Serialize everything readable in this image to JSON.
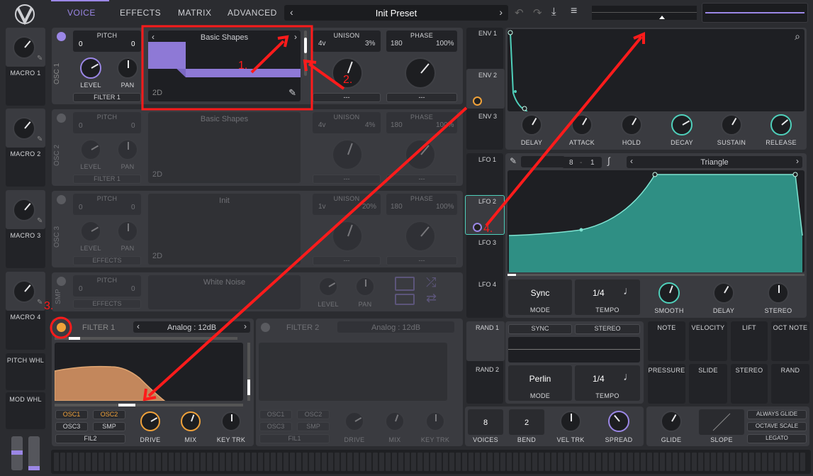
{
  "colors": {
    "accent_purple": "#9b87e6",
    "accent_teal": "#4fd0bb",
    "accent_orange": "#f0a23a",
    "annotation_red": "#ff1b1b"
  },
  "header": {
    "tabs": [
      "VOICE",
      "EFFECTS",
      "MATRIX",
      "ADVANCED"
    ],
    "preset": "Init Preset"
  },
  "macros": [
    {
      "label": "MACRO 1"
    },
    {
      "label": "MACRO 2"
    },
    {
      "label": "MACRO 3"
    },
    {
      "label": "MACRO 4"
    }
  ],
  "wheels": {
    "pitch": "PITCH WHL",
    "mod": "MOD WHL"
  },
  "osc": [
    {
      "name": "OSC 1",
      "pitch": "PITCH",
      "pitch_l": "0",
      "pitch_r": "0",
      "wave": "Basic Shapes",
      "dim": "2D",
      "unison": "UNISON",
      "voices": "4v",
      "detune": "3%",
      "phase": "PHASE",
      "phase_val": "180",
      "phase_pct": "100%",
      "level": "LEVEL",
      "pan": "PAN",
      "dest": "FILTER 1",
      "sel": "---"
    },
    {
      "name": "OSC 2",
      "pitch": "PITCH",
      "pitch_l": "0",
      "pitch_r": "0",
      "wave": "Basic Shapes",
      "dim": "2D",
      "unison": "UNISON",
      "voices": "4v",
      "detune": "4%",
      "phase": "PHASE",
      "phase_val": "180",
      "phase_pct": "100%",
      "level": "LEVEL",
      "pan": "PAN",
      "dest": "FILTER 1",
      "sel": "---"
    },
    {
      "name": "OSC 3",
      "pitch": "PITCH",
      "pitch_l": "0",
      "pitch_r": "0",
      "wave": "Init",
      "dim": "2D",
      "unison": "UNISON",
      "voices": "1v",
      "detune": "20%",
      "phase": "PHASE",
      "phase_val": "180",
      "phase_pct": "100%",
      "level": "LEVEL",
      "pan": "PAN",
      "dest": "EFFECTS",
      "sel": "---"
    }
  ],
  "smp": {
    "name": "SMP",
    "pitch": "PITCH",
    "pitch_l": "0",
    "pitch_r": "0",
    "wave": "White Noise",
    "level": "LEVEL",
    "pan": "PAN",
    "dest": "EFFECTS"
  },
  "filter1": {
    "name": "FILTER 1",
    "type": "Analog : 12dB",
    "routes": [
      "OSC1",
      "OSC2",
      "OSC3",
      "SMP"
    ],
    "fil": "FIL2",
    "drive": "DRIVE",
    "mix": "MIX",
    "keytrk": "KEY TRK"
  },
  "filter2": {
    "name": "FILTER 2",
    "type": "Analog : 12dB",
    "routes": [
      "OSC1",
      "OSC2",
      "OSC3",
      "SMP"
    ],
    "fil": "FIL1",
    "drive": "DRIVE",
    "mix": "MIX",
    "keytrk": "KEY TRK"
  },
  "env": {
    "labels": [
      "ENV 1",
      "ENV 2",
      "ENV 3"
    ],
    "knobs": [
      "DELAY",
      "ATTACK",
      "HOLD",
      "DECAY",
      "SUSTAIN",
      "RELEASE"
    ]
  },
  "lfo": {
    "labels": [
      "LFO 1",
      "LFO 2",
      "LFO 3",
      "LFO 4"
    ],
    "shape": "Triangle",
    "grid_l": "8",
    "grid_r": "1",
    "mode_val": "Sync",
    "mode": "MODE",
    "tempo_val": "1/4",
    "tempo": "TEMPO",
    "knobs": [
      "SMOOTH",
      "DELAY",
      "STEREO"
    ]
  },
  "rand": {
    "labels": [
      "RAND 1",
      "RAND 2"
    ],
    "sync": "SYNC",
    "stereo": "STEREO",
    "mode_val": "Perlin",
    "mode": "MODE",
    "tempo_val": "1/4",
    "tempo": "TEMPO"
  },
  "mods": [
    "NOTE",
    "VELOCITY",
    "LIFT",
    "OCT NOTE",
    "PRESSURE",
    "SLIDE",
    "STEREO",
    "RAND"
  ],
  "voice": {
    "voices": "8",
    "voices_lbl": "VOICES",
    "bend": "2",
    "bend_lbl": "BEND",
    "veltrk": "VEL TRK",
    "spread": "SPREAD",
    "glide": "GLIDE",
    "slope": "SLOPE",
    "opts": [
      "ALWAYS GLIDE",
      "OCTAVE SCALE",
      "LEGATO"
    ]
  },
  "annotations": [
    "1.",
    "2.",
    "3.",
    "4."
  ]
}
